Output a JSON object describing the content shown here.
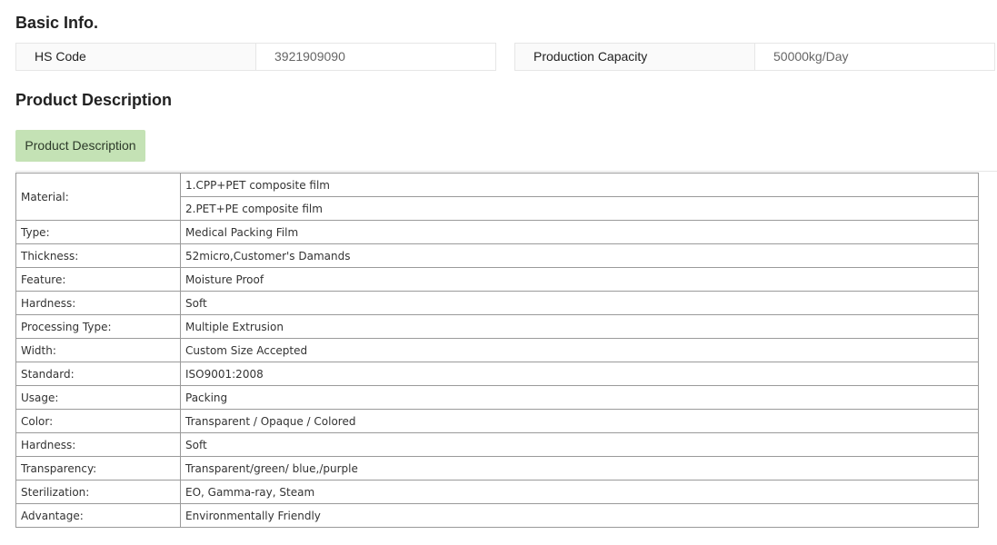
{
  "basic_info": {
    "title": "Basic Info.",
    "fields": [
      {
        "key": "HS Code",
        "value": "3921909090"
      },
      {
        "key": "Production Capacity",
        "value": "50000kg/Day"
      }
    ]
  },
  "description": {
    "title": "Product Description",
    "tab_label": "Product Description"
  },
  "spec_table": {
    "material": {
      "label": "Material:",
      "values": [
        "1.CPP+PET composite film",
        "2.PET+PE composite film"
      ]
    },
    "rows": [
      {
        "label": "Type:",
        "value": "Medical Packing Film"
      },
      {
        "label": "Thickness:",
        "value": "52micro,Customer's Damands"
      },
      {
        "label": "Feature:",
        "value": "Moisture Proof"
      },
      {
        "label": "Hardness:",
        "value": "Soft"
      },
      {
        "label": "Processing Type:",
        "value": "Multiple Extrusion"
      },
      {
        "label": "Width:",
        "value": "Custom Size Accepted"
      },
      {
        "label": "Standard:",
        "value": "ISO9001:2008"
      },
      {
        "label": "Usage:",
        "value": "Packing"
      },
      {
        "label": "Color:",
        "value": "Transparent / Opaque / Colored"
      },
      {
        "label": "Hardness:",
        "value": "Soft"
      },
      {
        "label": "Transparency:",
        "value": "Transparent/green/ blue,/purple"
      },
      {
        "label": "Sterilization:",
        "value": "EO, Gamma-ray, Steam"
      },
      {
        "label": "Advantage:",
        "value": "Environmentally Friendly"
      }
    ]
  },
  "colors": {
    "tab_bg": "#c4e2b5",
    "border": "#e6e6e6",
    "table_border": "#9a9a9a"
  }
}
